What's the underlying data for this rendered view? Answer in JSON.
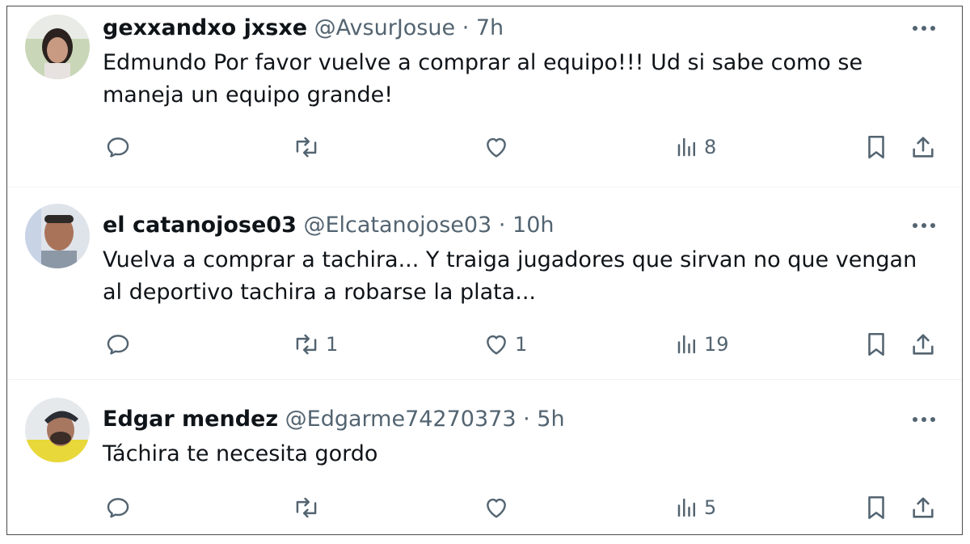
{
  "replies": [
    {
      "name": "gexxandxo jxsxe",
      "handle": "@AvsurJosue",
      "separator": "·",
      "time": "7h",
      "text": "Edmundo Por favor vuelve a comprar al equipo!!! Ud si sabe como se maneja un equipo grande!",
      "counts": {
        "reply": "",
        "retweet": "",
        "like": "",
        "views": "8"
      }
    },
    {
      "name": "el catanojose03",
      "handle": "@Elcatanojose03",
      "separator": "·",
      "time": "10h",
      "text": "Vuelva a comprar a tachira... Y traiga jugadores que sirvan no que vengan al deportivo tachira a robarse la plata...",
      "counts": {
        "reply": "",
        "retweet": "1",
        "like": "1",
        "views": "19"
      }
    },
    {
      "name": "Edgar mendez",
      "handle": "@Edgarme74270373",
      "separator": "·",
      "time": "5h",
      "text": "Táchira te necesita gordo",
      "counts": {
        "reply": "",
        "retweet": "",
        "like": "",
        "views": "5"
      }
    }
  ],
  "icons": {
    "reply": "reply-icon",
    "retweet": "retweet-icon",
    "like": "heart-icon",
    "views": "views-icon",
    "bookmark": "bookmark-icon",
    "share": "share-icon",
    "more": "more-icon"
  },
  "colors": {
    "text": "#0f1419",
    "secondary": "#536471",
    "divider": "#eff3f4"
  }
}
